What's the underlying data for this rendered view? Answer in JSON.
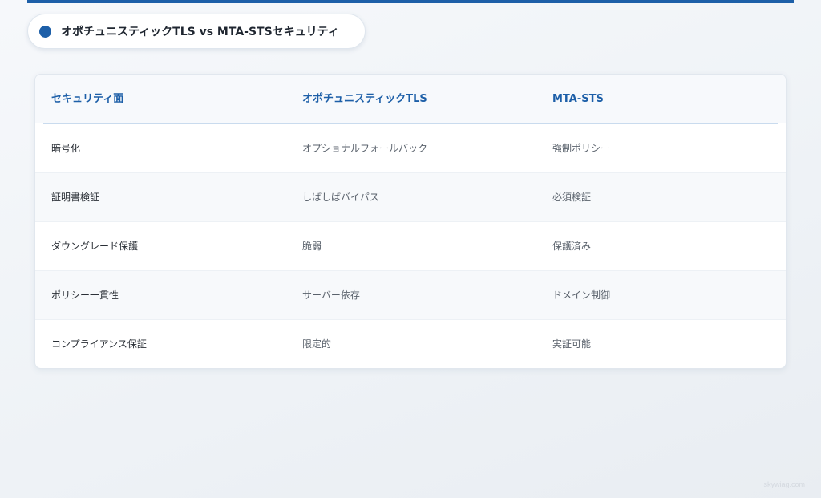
{
  "colors": {
    "accent": "#1d5fa8",
    "header_text": "#1d5fa8",
    "row_alt_bg": "#f7f9fb"
  },
  "title_badge": {
    "icon": "blue-dot-icon",
    "text": "オポチュニスティックTLS vs MTA-STSセキュリティ"
  },
  "table": {
    "headers": [
      "セキュリティ面",
      "オポチュニスティックTLS",
      "MTA-STS"
    ],
    "rows": [
      [
        "暗号化",
        "オプショナルフォールバック",
        "強制ポリシー"
      ],
      [
        "証明書検証",
        "しばしばバイパス",
        "必須検証"
      ],
      [
        "ダウングレード保護",
        "脆弱",
        "保護済み"
      ],
      [
        "ポリシー一貫性",
        "サーバー依存",
        "ドメイン制御"
      ],
      [
        "コンプライアンス保証",
        "限定的",
        "実証可能"
      ]
    ]
  },
  "watermark": "skywiag.com"
}
